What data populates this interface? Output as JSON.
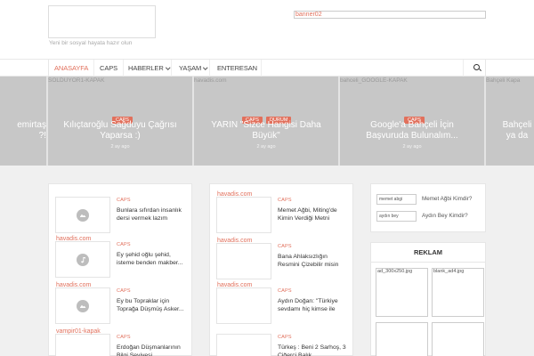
{
  "header": {
    "tagline": "Yeni bir sosyal hayata hazır olun",
    "banner": "banner02"
  },
  "nav": {
    "items": [
      {
        "label": "ANASAYFA",
        "active": true
      },
      {
        "label": "CAPS"
      },
      {
        "label": "HABERLER",
        "dropdown": true
      },
      {
        "label": "YAŞAM",
        "dropdown": true
      },
      {
        "label": "ENTERESAN"
      }
    ]
  },
  "slider": [
    {
      "title": "emirtaş\n?!",
      "link": "",
      "cats": [],
      "time": ""
    },
    {
      "title": "Kılıçtaroğlu Sağduyu Çağrısı\nYaparsa :)",
      "link": "SOLDUYOR1-KAPAK",
      "cats": [
        "CAPS"
      ],
      "time": "2 ay ago"
    },
    {
      "title": "YARIN \"Sizce Hangisi Daha\nBüyük\"",
      "link": "havadis.com",
      "cats": [
        "CAPS",
        "DURUM"
      ],
      "time": "2 ay ago"
    },
    {
      "title": "Google'a Bahçeli İçin\nBaşvuruda Bulunalım...",
      "link": "bahceli_GOOGLE-KAPAK",
      "cats": [
        "CAPS"
      ],
      "time": "2 ay ago"
    },
    {
      "title": "Bahçeli\nya da",
      "link": "Bahçeli Kapa",
      "cats": [],
      "time": ""
    }
  ],
  "columns": [
    [
      {
        "link": "",
        "cat": "CAPS",
        "title": "Bunlara sıfırdan insanlık dersi vermek lazım",
        "icon": "image"
      },
      {
        "link": "havadis.com",
        "cat": "CAPS",
        "title": "Ey şehid oğlu şehid, isteme benden makber...",
        "icon": "music"
      },
      {
        "link": "havadis.com",
        "cat": "CAPS",
        "title": "Ey bu Topraklar için Toprağa Düşmüş Asker...",
        "icon": "image"
      },
      {
        "link": "vampir01-kapak",
        "cat": "CAPS",
        "title": "Erdoğan Düşmanlarının Bilgi Seviyesi",
        "icon": "image"
      }
    ],
    [
      {
        "link": "havadis.com",
        "cat": "CAPS",
        "title": "Memet Ağbi, Miting'de Kimin Verdiği Metni",
        "icon": "none"
      },
      {
        "link": "havadis.com",
        "cat": "CAPS",
        "title": "Bana Ahlaksızlığın Resmini Çizebilir misin",
        "icon": "none"
      },
      {
        "link": "havadis.com",
        "cat": "CAPS",
        "title": "Aydın Doğan: \"Türkiye sevdamı hiç kimse ile",
        "icon": "none"
      },
      {
        "link": "",
        "cat": "CAPS",
        "title": "Türkeş : Beni 2 Sarhoş, 3 Ciğerci Balık",
        "icon": "none"
      }
    ]
  ],
  "sidebar": {
    "people": [
      {
        "img": "memet abgi",
        "name": "Memet Ağbi Kimdir?"
      },
      {
        "img": "aydın bey",
        "name": "Aydın Bey Kimdir?"
      }
    ],
    "reklam": {
      "title": "REKLAM",
      "ads": [
        "ad_300x250.jpg",
        "blank_ad4.jpg",
        "",
        ""
      ]
    }
  }
}
